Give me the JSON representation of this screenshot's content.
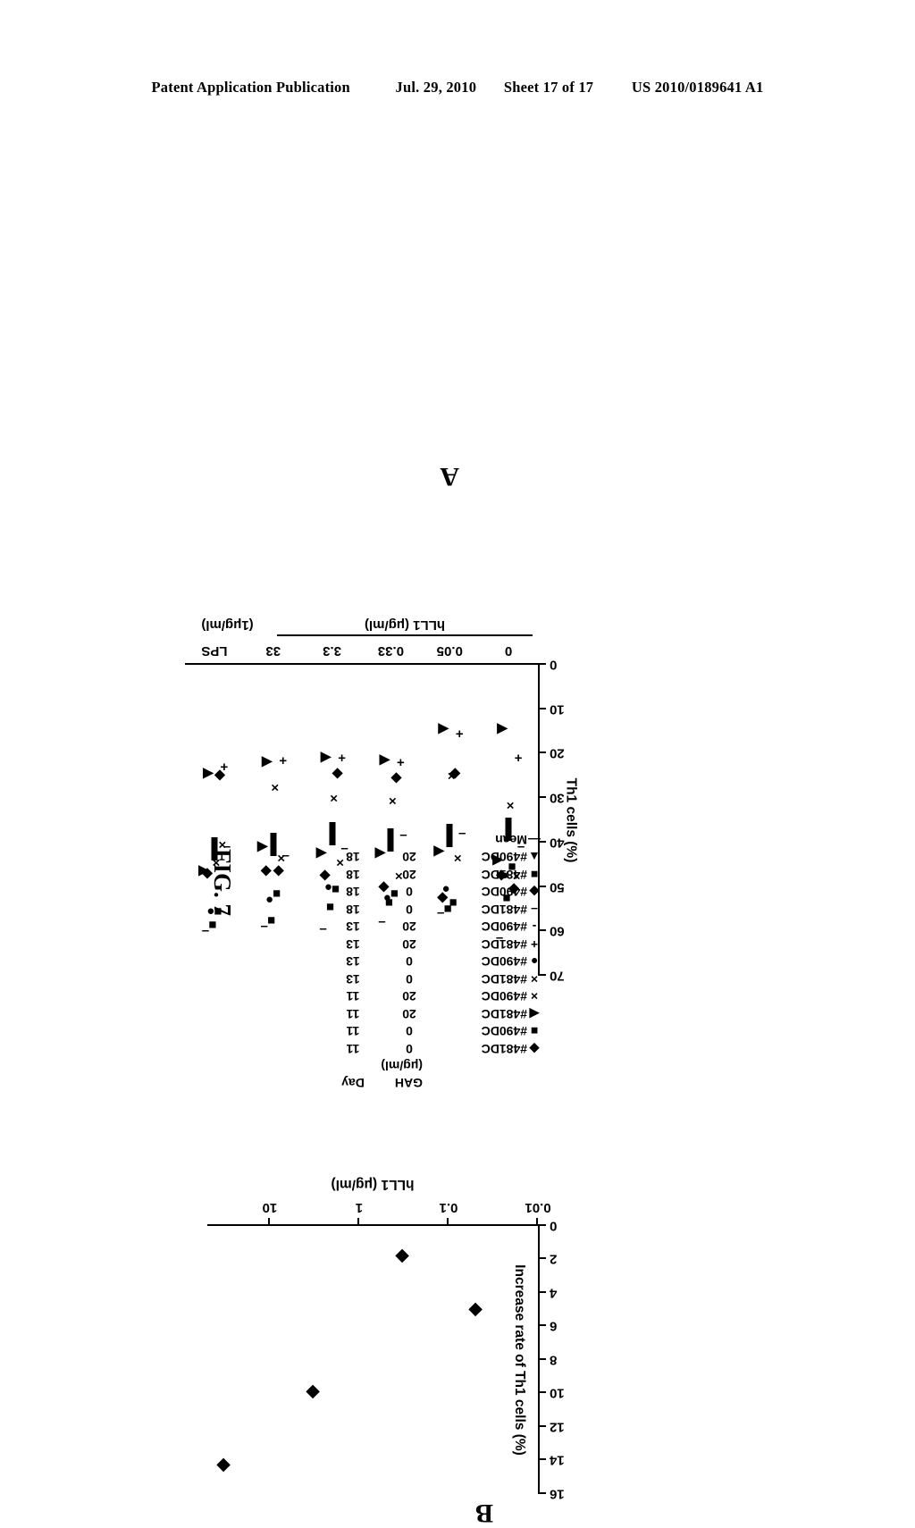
{
  "header": {
    "publication": "Patent Application Publication",
    "date": "Jul. 29, 2010",
    "sheet": "Sheet 17 of 17",
    "number": "US 2010/0189641 A1"
  },
  "figure": {
    "label": "FIG. 7",
    "panelA_letter": "A",
    "panelB_letter": "B"
  },
  "panelA": {
    "ylabel": "Th1 cells (%)",
    "yticks": [
      "0",
      "10",
      "20",
      "30",
      "40",
      "50",
      "60",
      "70"
    ],
    "xgroups": [
      "0",
      "0.05",
      "0.33",
      "3.3",
      "33",
      "LPS"
    ],
    "xlabel_main": "hLL1 (μg/ml)",
    "xlabel_lps": "(1μg/ml)",
    "legend": {
      "header_gah": "GAH",
      "header_gah_unit": "(μg/ml)",
      "header_day": "Day",
      "rows": [
        {
          "symbol": "◆",
          "name": "#481DC",
          "gah": "0",
          "day": "11"
        },
        {
          "symbol": "■",
          "name": "#490DC",
          "gah": "0",
          "day": "11"
        },
        {
          "symbol": "◀",
          "name": "#481DC",
          "gah": "20",
          "day": "11"
        },
        {
          "symbol": "×",
          "name": "#490DC",
          "gah": "20",
          "day": "11"
        },
        {
          "symbol": "×",
          "name": "#481DC",
          "gah": "0",
          "day": "13"
        },
        {
          "symbol": "●",
          "name": "#490DC",
          "gah": "0",
          "day": "13"
        },
        {
          "symbol": "+",
          "name": "#481DC",
          "gah": "20",
          "day": "13"
        },
        {
          "symbol": "-",
          "name": "#490DC",
          "gah": "20",
          "day": "13"
        },
        {
          "symbol": "–",
          "name": "#481DC",
          "gah": "0",
          "day": "18"
        },
        {
          "symbol": "◆",
          "name": "#490DC",
          "gah": "0",
          "day": "18"
        },
        {
          "symbol": "■",
          "name": "#481DC",
          "gah": "20",
          "day": "18"
        },
        {
          "symbol": "▲",
          "name": "#490DC",
          "gah": "20",
          "day": "18"
        },
        {
          "symbol": "—",
          "name": "Mean",
          "gah": "",
          "day": ""
        }
      ]
    }
  },
  "panelB": {
    "ylabel": "Increase rate of Th1 cells (%)",
    "yticks": [
      "0",
      "2",
      "4",
      "6",
      "8",
      "10",
      "12",
      "14",
      "16"
    ],
    "xlabel": "hLL1 (μg/ml)",
    "xticks": [
      "0.01",
      "0.1",
      "1",
      "10"
    ]
  },
  "chart_data": [
    {
      "type": "scatter",
      "panel": "A",
      "title": "",
      "xlabel": "hLL1 (μg/ml)",
      "ylabel": "Th1 cells (%)",
      "ylim": [
        0,
        70
      ],
      "categories": [
        "0",
        "0.05",
        "0.33",
        "3.3",
        "33",
        "LPS"
      ],
      "grid": false,
      "legend_position": "top-left",
      "series": [
        {
          "name": "#481DC GAH 0 Day 11",
          "marker": "diamond",
          "values": [
            50.5,
            24.5,
            25.5,
            24.5,
            46.5,
            25.0
          ]
        },
        {
          "name": "#490DC GAH 0 Day 11",
          "marker": "square",
          "values": [
            52.5,
            55.0,
            53.5,
            54.5,
            57.5,
            58.5
          ]
        },
        {
          "name": "#481DC GAH 20 Day 11",
          "marker": "triangle",
          "values": [
            14.5,
            14.5,
            21.5,
            21.0,
            22.0,
            24.5
          ]
        },
        {
          "name": "#490DC GAH 20 Day 11",
          "marker": "cross",
          "values": [
            31.5,
            25.0,
            30.5,
            30.0,
            27.5,
            44.5
          ]
        },
        {
          "name": "#481DC GAH 0 Day 13",
          "marker": "cross2",
          "values": [
            47.5,
            43.5,
            47.5,
            44.5,
            43.5,
            40.5
          ]
        },
        {
          "name": "#490DC GAH 0 Day 13",
          "marker": "circle",
          "values": [
            47.5,
            50.5,
            52.5,
            50.0,
            53.0,
            55.5
          ]
        },
        {
          "name": "#481DC GAH 20 Day 13",
          "marker": "plus",
          "values": [
            21.0,
            15.5,
            22.0,
            21.0,
            21.5,
            23.0
          ]
        },
        {
          "name": "#490DC GAH 20 Day 13",
          "marker": "dash",
          "values": [
            61.5,
            56.0,
            58.0,
            59.5,
            59.0,
            60.0
          ]
        },
        {
          "name": "#481DC GAH 0 Day 18",
          "marker": "dash2",
          "values": [
            41.0,
            38.0,
            38.5,
            41.5,
            43.0,
            41.0
          ]
        },
        {
          "name": "#490DC GAH 0 Day 18",
          "marker": "diamond2",
          "values": [
            47.5,
            52.5,
            50.0,
            47.5,
            46.5,
            47.0
          ]
        },
        {
          "name": "#481DC GAH 20 Day 18",
          "marker": "square2",
          "values": [
            45.5,
            53.5,
            51.5,
            50.5,
            51.5,
            55.5
          ]
        },
        {
          "name": "#490DC GAH 20 Day 18",
          "marker": "triangle2",
          "values": [
            44.0,
            42.0,
            42.5,
            42.5,
            41.0,
            46.5
          ]
        },
        {
          "name": "Mean",
          "marker": "bar",
          "values": [
            37.0,
            38.5,
            39.5,
            38.0,
            40.5,
            41.5
          ]
        }
      ]
    },
    {
      "type": "scatter",
      "panel": "B",
      "title": "",
      "xlabel": "hLL1 (μg/ml)",
      "ylabel": "Increase rate of Th1 cells (%)",
      "xscale": "log",
      "xlim": [
        0.01,
        50
      ],
      "ylim": [
        0,
        16
      ],
      "grid": false,
      "x": [
        0.05,
        0.33,
        3.3,
        33
      ],
      "values": [
        5.0,
        1.8,
        9.9,
        14.3
      ],
      "marker": "diamond"
    }
  ]
}
